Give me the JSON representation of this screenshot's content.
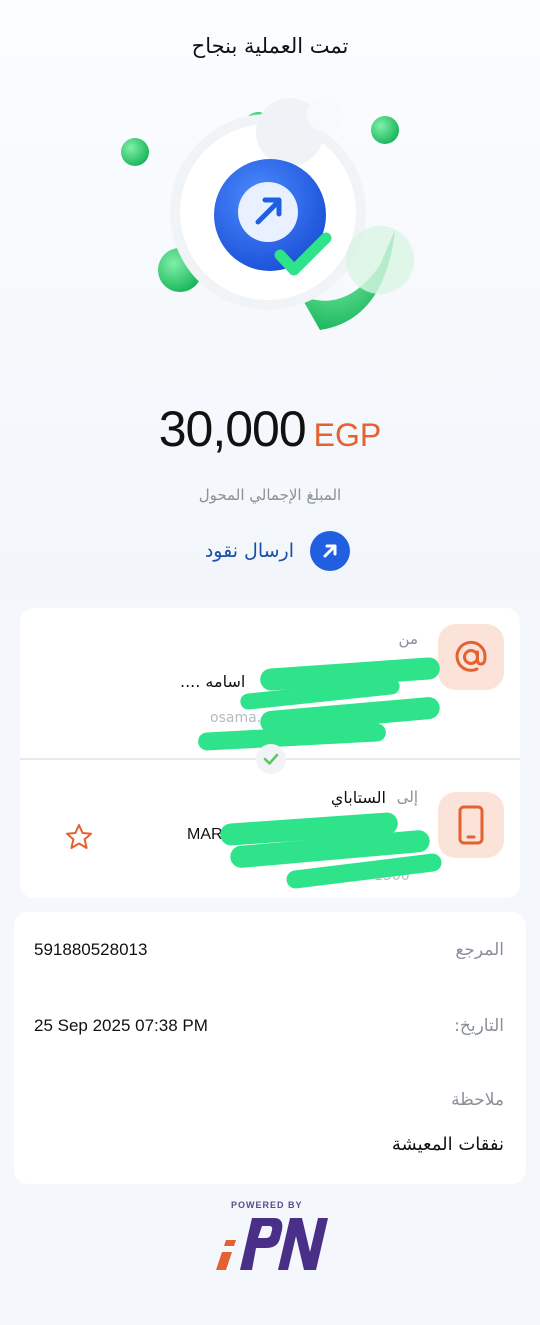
{
  "header": {
    "title": "تمت العملية بنجاح"
  },
  "transaction": {
    "amount": "30,000",
    "currency": "EGP",
    "subtitle": "المبلغ الإجمالي المحول",
    "action_label": "ارسال نقود"
  },
  "sender": {
    "label": "من",
    "name": "اسامه ....",
    "handle": "osama......pay"
  },
  "receiver": {
    "label": "إلى",
    "bank": "الستاباي",
    "name": "MARY............S**** ******",
    "mobile_tail": "1500"
  },
  "details": {
    "reference_label": "المرجع",
    "reference_value": "591880528013",
    "date_label": "التاريخ:",
    "date_value": "25 Sep 2025 07:38 PM",
    "note_label": "ملاحظة",
    "note_value": "نفقات المعيشة"
  },
  "footer": {
    "powered_by": "POWERED BY",
    "brand": "IPN"
  },
  "colors": {
    "accent_blue": "#1f5fe0",
    "accent_orange": "#e3622f",
    "success_green": "#2ecc71",
    "icon_bg": "#fbe3da"
  },
  "icons": {
    "hero": "send-arrow-check-icon",
    "action": "arrow-up-right-icon",
    "sender": "at-icon",
    "receiver": "mobile-phone-icon",
    "favorite": "star-icon"
  }
}
